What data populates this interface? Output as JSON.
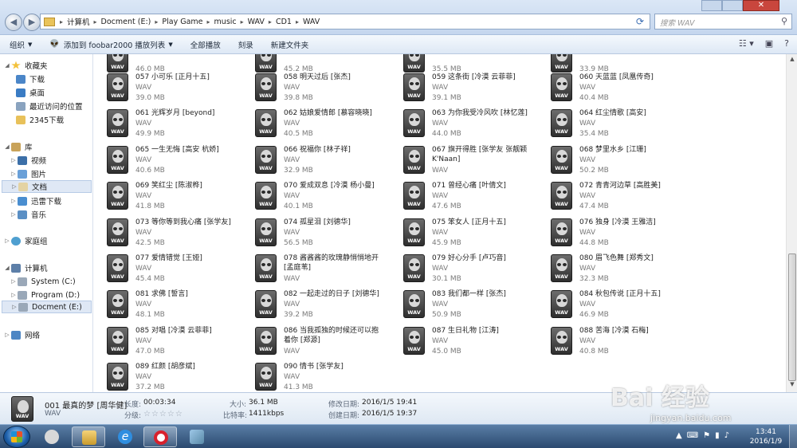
{
  "address": {
    "crumbs": [
      "计算机",
      "Docment (E:)",
      "Play Game",
      "music",
      "WAV",
      "CD1",
      "WAV"
    ],
    "search_placeholder": "搜索 WAV"
  },
  "toolbar": {
    "organize": "组织",
    "add_foobar": "添加到 foobar2000 播放列表",
    "play_all": "全部播放",
    "burn": "刻录",
    "new_folder": "新建文件夹"
  },
  "sidebar": {
    "favorites": "收藏夹",
    "fav_items": [
      "下载",
      "桌面",
      "最近访问的位置",
      "2345下载"
    ],
    "libraries": "库",
    "lib_items": [
      "视频",
      "图片",
      "文档",
      "迅雷下载",
      "音乐"
    ],
    "homegroup": "家庭组",
    "computer": "计算机",
    "drives": [
      "System (C:)",
      "Program (D:)",
      "Docment (E:)"
    ],
    "network": "网络"
  },
  "files": {
    "top_row_sizes": [
      "46.0 MB",
      "45.2 MB",
      "35.5 MB",
      "33.9 MB"
    ],
    "items": [
      {
        "name": "057 小可乐 [正月十五]",
        "type": "WAV",
        "size": "39.0 MB"
      },
      {
        "name": "058 明天过后 [张杰]",
        "type": "WAV",
        "size": "39.8 MB"
      },
      {
        "name": "059 这条街 [冷漠 云菲菲]",
        "type": "WAV",
        "size": "39.1 MB"
      },
      {
        "name": "060 天蓝蓝 [凤凰传奇]",
        "type": "WAV",
        "size": "40.4 MB"
      },
      {
        "name": "061 光辉岁月 [beyond]",
        "type": "WAV",
        "size": "49.9 MB"
      },
      {
        "name": "062 姑娘爱情郎 [慕容晓晓]",
        "type": "WAV",
        "size": "40.5 MB"
      },
      {
        "name": "063 为你我受冷风吹 [林忆莲]",
        "type": "WAV",
        "size": "44.0 MB"
      },
      {
        "name": "064 红尘情歌 [高安]",
        "type": "WAV",
        "size": "35.4 MB"
      },
      {
        "name": "065 一生无悔 [高安 杭娇]",
        "type": "WAV",
        "size": "40.6 MB"
      },
      {
        "name": "066 祝福你 [林子祥]",
        "type": "WAV",
        "size": "32.9 MB"
      },
      {
        "name": "067 旗开得胜 [张学友 张靓颖 K'Naan]",
        "type": "WAV",
        "size": ""
      },
      {
        "name": "068 梦里水乡 [江珊]",
        "type": "WAV",
        "size": "50.2 MB"
      },
      {
        "name": "069 笑红尘 [陈淑桦]",
        "type": "WAV",
        "size": "41.8 MB"
      },
      {
        "name": "070 爱成双息 [冷漠 杨小曼]",
        "type": "WAV",
        "size": "40.1 MB"
      },
      {
        "name": "071 曾经心痛 [叶倩文]",
        "type": "WAV",
        "size": "47.6 MB"
      },
      {
        "name": "072 青青河边草 [高胜美]",
        "type": "WAV",
        "size": "47.4 MB"
      },
      {
        "name": "073 等你等到我心痛 [张学友]",
        "type": "WAV",
        "size": "42.5 MB"
      },
      {
        "name": "074 孤星泪 [刘德华]",
        "type": "WAV",
        "size": "56.5 MB"
      },
      {
        "name": "075 笨女人 [正月十五]",
        "type": "WAV",
        "size": "45.9 MB"
      },
      {
        "name": "076 独身 [冷漠 王雅洁]",
        "type": "WAV",
        "size": "44.8 MB"
      },
      {
        "name": "077 爱情错觉 [王娅]",
        "type": "WAV",
        "size": "45.4 MB"
      },
      {
        "name": "078 酱酱酱的玫瑰静悄悄地开 [孟庭苇]",
        "type": "WAV",
        "size": ""
      },
      {
        "name": "079 好心分手 [卢巧音]",
        "type": "WAV",
        "size": "30.1 MB"
      },
      {
        "name": "080 眉飞色舞 [郑秀文]",
        "type": "WAV",
        "size": "32.3 MB"
      },
      {
        "name": "081 求佛 [誓言]",
        "type": "WAV",
        "size": "48.1 MB"
      },
      {
        "name": "082 一起走过的日子 [刘德华]",
        "type": "WAV",
        "size": "39.2 MB"
      },
      {
        "name": "083 我们都一样 [张杰]",
        "type": "WAV",
        "size": "50.9 MB"
      },
      {
        "name": "084 秋包传说 [正月十五]",
        "type": "WAV",
        "size": "46.9 MB"
      },
      {
        "name": "085 对唱 [冷漠 云菲菲]",
        "type": "WAV",
        "size": "47.0 MB"
      },
      {
        "name": "086 当我孤独的时候还可以抱着你 [郑源]",
        "type": "WAV",
        "size": ""
      },
      {
        "name": "087 生日礼物 [江涛]",
        "type": "WAV",
        "size": "45.0 MB"
      },
      {
        "name": "088 苦海 [冷漠 石梅]",
        "type": "WAV",
        "size": "40.8 MB"
      },
      {
        "name": "089 红颜 [胡彦斌]",
        "type": "WAV",
        "size": "37.2 MB"
      },
      {
        "name": "090 情书 [张学友]",
        "type": "WAV",
        "size": "41.3 MB"
      }
    ]
  },
  "details": {
    "name": "001 最真的梦 [周华健]",
    "type": "WAV",
    "length_label": "长度:",
    "length": "00:03:34",
    "rating_label": "分级:",
    "size_label": "大小:",
    "size": "36.1 MB",
    "bitrate_label": "比特率:",
    "bitrate": "1411kbps",
    "modified_label": "修改日期:",
    "modified": "2016/1/5 19:41",
    "created_label": "创建日期:",
    "created": "2016/1/5 19:37"
  },
  "taskbar": {
    "time": "13:41",
    "date": "2016/1/9"
  },
  "watermark": {
    "text": "Bai 经验",
    "url": "jingyan.baidu.com"
  }
}
